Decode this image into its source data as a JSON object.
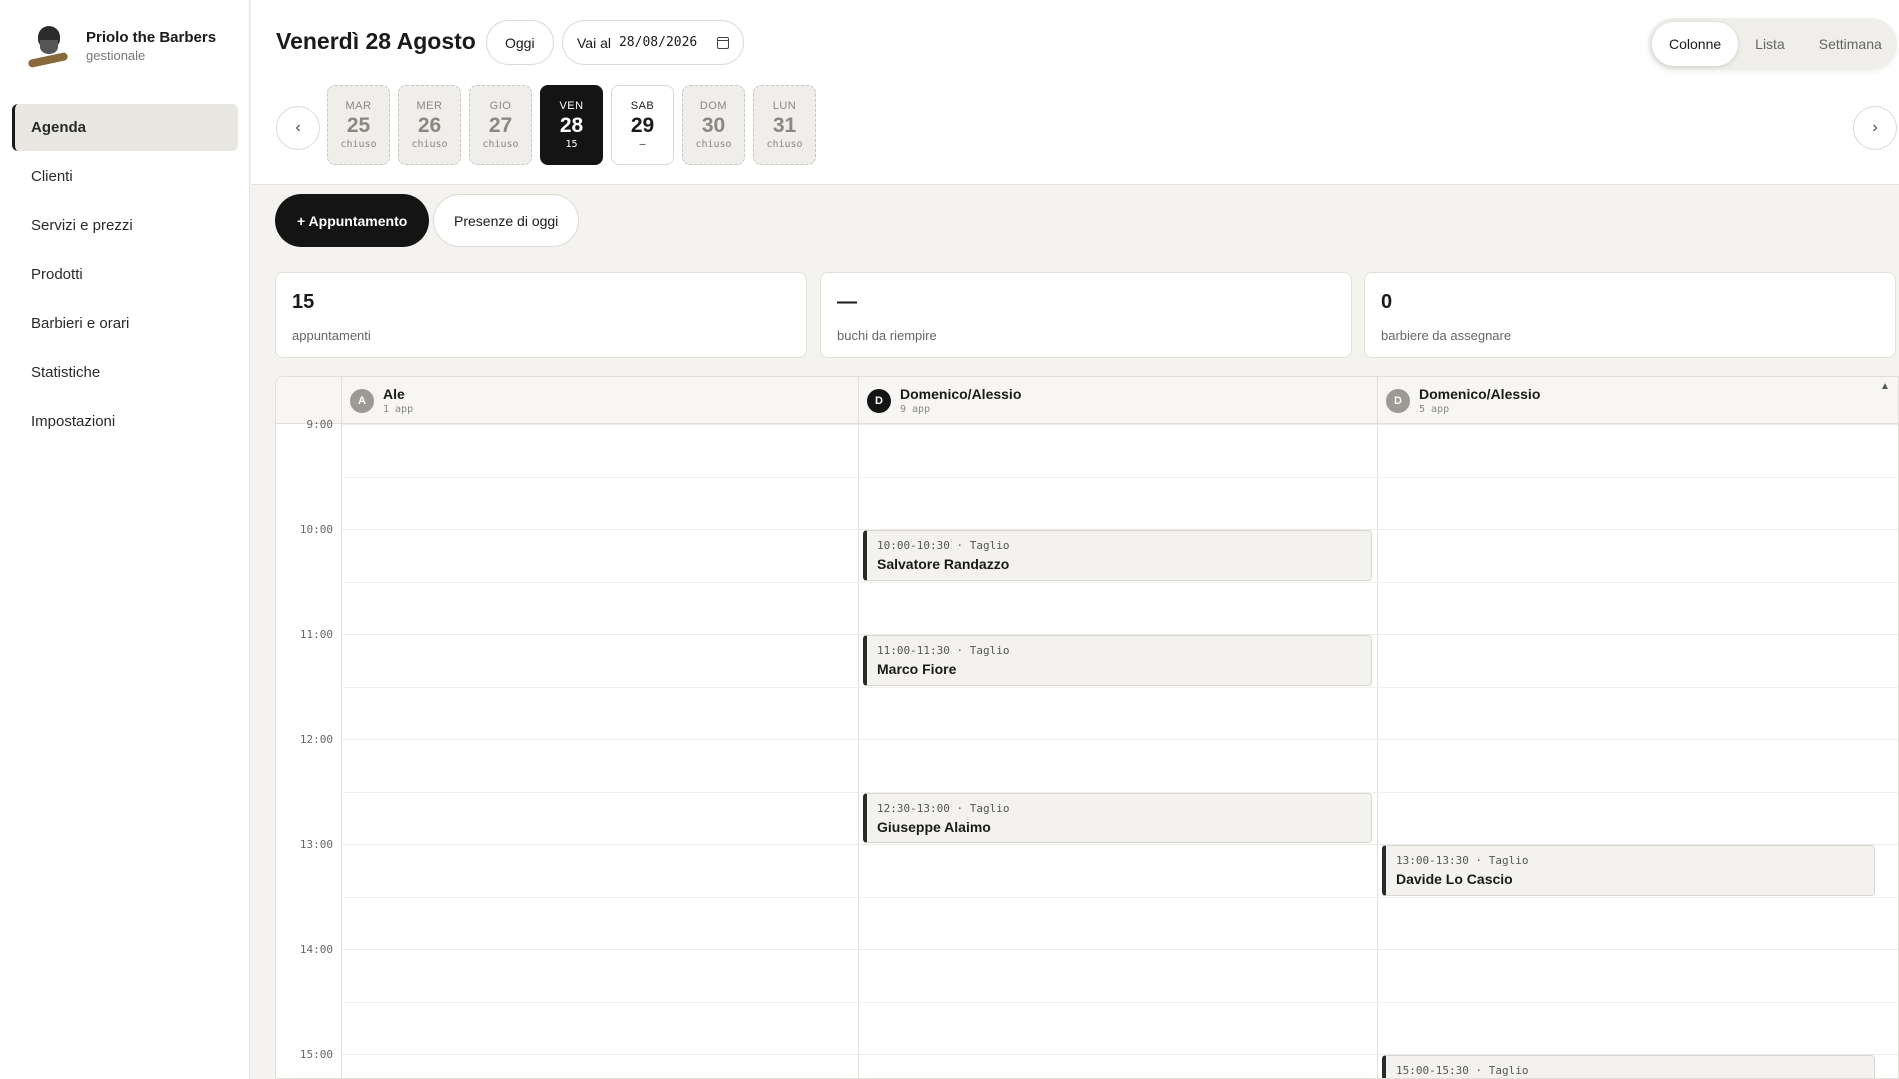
{
  "brand": {
    "name": "Priolo the Barbers",
    "subtitle": "gestionale"
  },
  "nav": [
    {
      "label": "Agenda",
      "active": true
    },
    {
      "label": "Clienti"
    },
    {
      "label": "Servizi e prezzi"
    },
    {
      "label": "Prodotti"
    },
    {
      "label": "Barbieri e orari"
    },
    {
      "label": "Statistiche"
    },
    {
      "label": "Impostazioni"
    }
  ],
  "header": {
    "title": "Venerdì 28 Agosto",
    "today_label": "Oggi",
    "goto_label": "Vai al",
    "goto_date": "28/08/2026",
    "views": [
      "Colonne",
      "Lista",
      "Settimana"
    ],
    "active_view": "Colonne",
    "prev_arrow": "‹",
    "next_arrow": "›"
  },
  "days": [
    {
      "weekday": "MAR",
      "num": "25",
      "sub": "chiuso",
      "state": "closed"
    },
    {
      "weekday": "MER",
      "num": "26",
      "sub": "chiuso",
      "state": "closed"
    },
    {
      "weekday": "GIO",
      "num": "27",
      "sub": "chiuso",
      "state": "closed"
    },
    {
      "weekday": "VEN",
      "num": "28",
      "sub": "15",
      "state": "selected"
    },
    {
      "weekday": "SAB",
      "num": "29",
      "sub": "—",
      "state": "open"
    },
    {
      "weekday": "DOM",
      "num": "30",
      "sub": "chiuso",
      "state": "closed"
    },
    {
      "weekday": "LUN",
      "num": "31",
      "sub": "chiuso",
      "state": "closed"
    }
  ],
  "actions": {
    "new_appointment": "+ Appuntamento",
    "presence": "Presenze di oggi"
  },
  "stats": [
    {
      "value": "15",
      "label": "appuntamenti"
    },
    {
      "value": "—",
      "label": "buchi da riempire"
    },
    {
      "value": "0",
      "label": "barbiere da assegnare"
    }
  ],
  "calendar": {
    "hours": [
      "9:00",
      "10:00",
      "11:00",
      "12:00",
      "13:00",
      "14:00",
      "15:00"
    ],
    "columns": [
      {
        "initial": "A",
        "name": "Ale",
        "count": "1 app",
        "dark": false
      },
      {
        "initial": "D",
        "name": "Domenico/Alessio",
        "count": "9 app",
        "dark": true
      },
      {
        "initial": "D",
        "name": "Domenico/Alessio",
        "count": "5 app",
        "dark": false
      }
    ],
    "appointments": [
      {
        "col": 1,
        "start": 10.0,
        "end": 10.5,
        "time": "10:00-10:30 · Taglio",
        "client": "Salvatore Randazzo"
      },
      {
        "col": 1,
        "start": 11.0,
        "end": 11.5,
        "time": "11:00-11:30 · Taglio",
        "client": "Marco Fiore"
      },
      {
        "col": 1,
        "start": 12.5,
        "end": 13.0,
        "time": "12:30-13:00 · Taglio",
        "client": "Giuseppe Alaimo"
      },
      {
        "col": 2,
        "start": 13.0,
        "end": 13.5,
        "time": "13:00-13:30 · Taglio",
        "client": "Davide Lo Cascio"
      },
      {
        "col": 2,
        "start": 15.0,
        "end": 15.5,
        "time": "15:00-15:30 · Taglio",
        "client": ""
      }
    ]
  }
}
